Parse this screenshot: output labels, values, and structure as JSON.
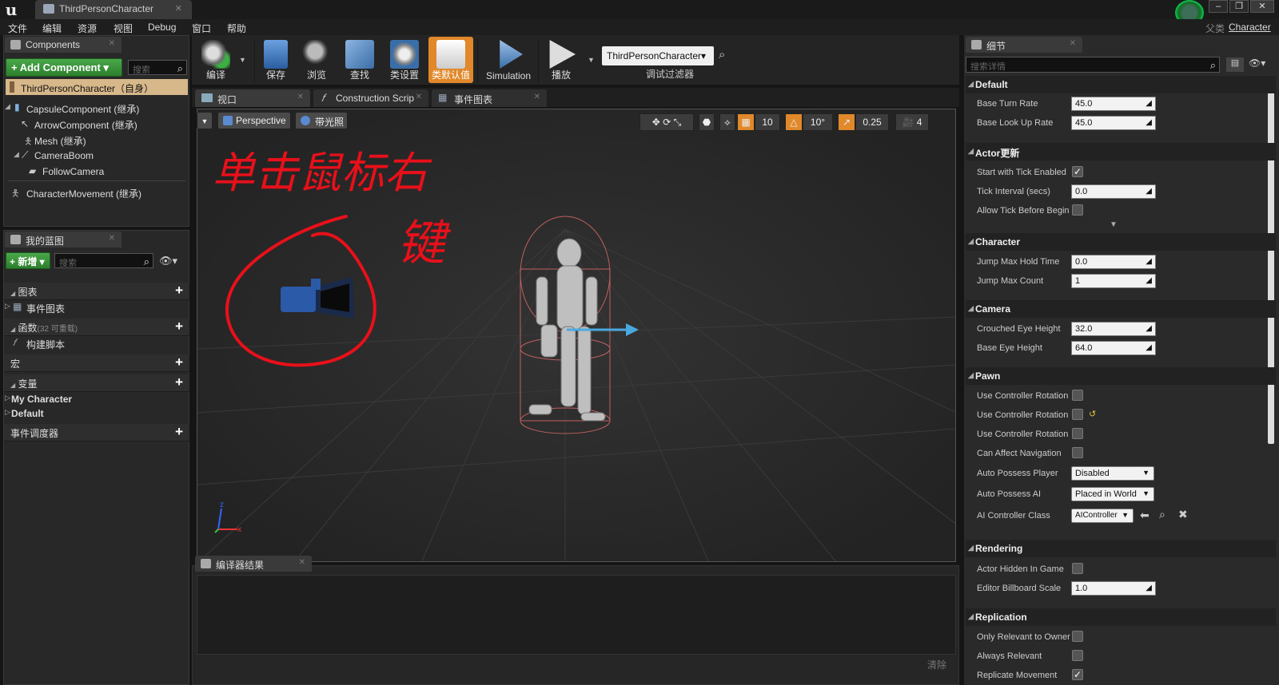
{
  "app": {
    "tab_title": "ThirdPersonCharacter",
    "parent_label": "父类",
    "parent_class": "Character"
  },
  "menu": [
    "文件",
    "编辑",
    "资源",
    "视图",
    "Debug",
    "窗口",
    "帮助"
  ],
  "components": {
    "tab": "Components",
    "add_button": "+ Add Component ▾",
    "search_placeholder": "搜索",
    "root": "ThirdPersonCharacter（自身）",
    "items": [
      "CapsuleComponent (继承)",
      "ArrowComponent (继承)",
      "Mesh (继承)",
      "CameraBoom",
      "FollowCamera",
      "CharacterMovement (继承)"
    ]
  },
  "my_blueprint": {
    "tab": "我的蓝图",
    "add_button": "+ 新增 ▾",
    "search_placeholder": "搜索",
    "graphs": "图表",
    "event_graph": "事件图表",
    "functions": "函数",
    "functions_count": "(32 可重载)",
    "construction_script": "构建脚本",
    "macros": "宏",
    "variables": "变量",
    "var_categories": [
      "My Character",
      "Default"
    ],
    "dispatchers": "事件调度器"
  },
  "toolbar": {
    "compile": "编译",
    "save": "保存",
    "browse": "浏览",
    "find": "查找",
    "class_settings": "类设置",
    "class_defaults": "类默认值",
    "simulation": "Simulation",
    "play": "播放",
    "debug_object": "ThirdPersonCharacter▾",
    "debug_filter": "调试过滤器"
  },
  "editor_tabs": [
    "视口",
    "Construction Scrip",
    "事件图表"
  ],
  "viewport": {
    "perspective": "Perspective",
    "lit": "带光照",
    "grid_snap": "10",
    "rot_snap": "10°",
    "scale_snap": "0.25",
    "cam_speed": "4",
    "axis_x": "x",
    "axis_z": "z",
    "annotation_line1": "单击鼠标右",
    "annotation_line2": "键"
  },
  "compiler": {
    "tab": "编译器结果",
    "clear": "清除"
  },
  "details": {
    "tab": "细节",
    "search_placeholder": "搜索详情",
    "sections": {
      "default": "Default",
      "actor_tick": "Actor更新",
      "character": "Character",
      "camera": "Camera",
      "pawn": "Pawn",
      "rendering": "Rendering",
      "replication": "Replication"
    },
    "props": {
      "base_turn_rate": {
        "label": "Base Turn Rate",
        "value": "45.0"
      },
      "base_look_up_rate": {
        "label": "Base Look Up Rate",
        "value": "45.0"
      },
      "start_tick": {
        "label": "Start with Tick Enabled",
        "checked": true
      },
      "tick_interval": {
        "label": "Tick Interval (secs)",
        "value": "0.0"
      },
      "allow_tick": {
        "label": "Allow Tick Before Begin",
        "checked": false
      },
      "jump_hold": {
        "label": "Jump Max Hold Time",
        "value": "0.0"
      },
      "jump_count": {
        "label": "Jump Max Count",
        "value": "1"
      },
      "crouched_eye": {
        "label": "Crouched Eye Height",
        "value": "32.0"
      },
      "base_eye": {
        "label": "Base Eye Height",
        "value": "64.0"
      },
      "use_ctrl_rot_1": {
        "label": "Use Controller Rotation",
        "checked": false
      },
      "use_ctrl_rot_2": {
        "label": "Use Controller Rotation",
        "checked": false
      },
      "use_ctrl_rot_3": {
        "label": "Use Controller Rotation",
        "checked": false
      },
      "can_affect_nav": {
        "label": "Can Affect Navigation",
        "checked": false
      },
      "auto_possess_player": {
        "label": "Auto Possess Player",
        "value": "Disabled"
      },
      "auto_possess_ai": {
        "label": "Auto Possess AI",
        "value": "Placed in World"
      },
      "ai_controller": {
        "label": "AI Controller Class",
        "value": "AIController"
      },
      "hidden_in_game": {
        "label": "Actor Hidden In Game",
        "checked": false
      },
      "billboard_scale": {
        "label": "Editor Billboard Scale",
        "value": "1.0"
      },
      "only_relevant": {
        "label": "Only Relevant to Owner",
        "checked": false
      },
      "always_relevant": {
        "label": "Always Relevant",
        "checked": false
      },
      "replicate_movement": {
        "label": "Replicate Movement",
        "checked": true
      }
    }
  },
  "colors": {
    "accent_green": "#2d7f2d",
    "class_defaults_orange": "#e0882a",
    "annotation_red": "#e8101a"
  }
}
